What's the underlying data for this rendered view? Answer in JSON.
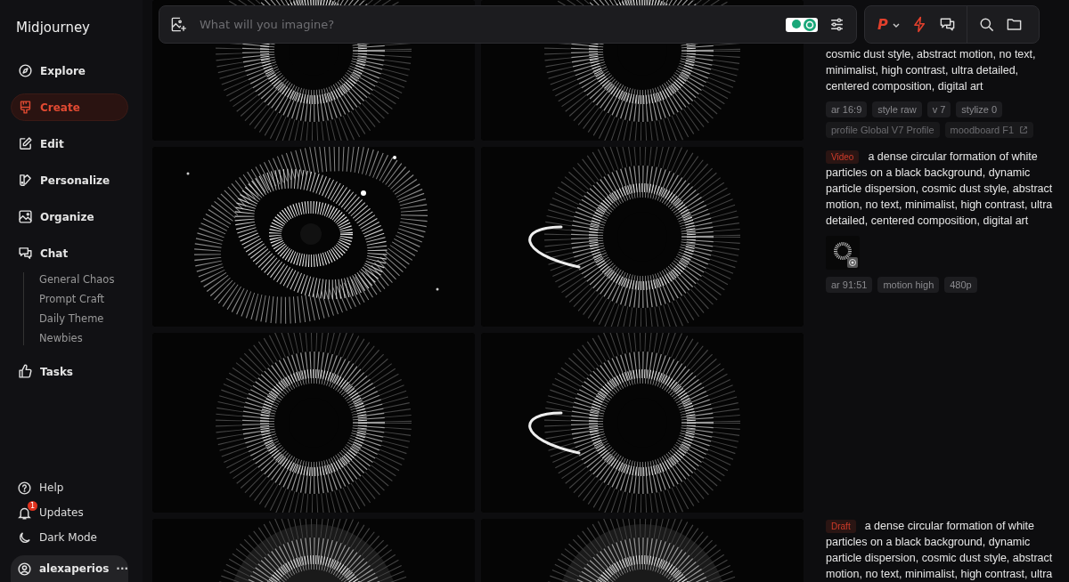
{
  "sidebar": {
    "logo": "Midjourney",
    "nav": [
      {
        "label": "Explore",
        "selected": false
      },
      {
        "label": "Create",
        "selected": true
      },
      {
        "label": "Edit",
        "selected": false
      },
      {
        "label": "Personalize",
        "selected": false
      },
      {
        "label": "Organize",
        "selected": false
      },
      {
        "label": "Chat",
        "selected": false,
        "children": [
          {
            "label": "General Chaos"
          },
          {
            "label": "Prompt Craft"
          },
          {
            "label": "Daily Theme"
          },
          {
            "label": "Newbies"
          }
        ]
      },
      {
        "label": "Tasks",
        "selected": false
      }
    ],
    "footer": [
      {
        "label": "Help"
      },
      {
        "label": "Updates",
        "badge": "1"
      },
      {
        "label": "Dark Mode"
      }
    ],
    "user": {
      "name": "alexaperios",
      "menu": "···"
    }
  },
  "prompt_bar": {
    "placeholder": "What will you imagine?"
  },
  "actions": {
    "profile_letter": "P"
  },
  "gallery": {
    "rows": [
      [
        {
          "kind": "picture"
        },
        {
          "kind": "picture"
        }
      ],
      [
        {
          "kind": "picture"
        },
        {
          "kind": "picture"
        }
      ],
      [
        {
          "kind": "picture"
        },
        {
          "kind": "picture"
        }
      ],
      [
        {
          "kind": "picture"
        },
        {
          "kind": "picture"
        }
      ]
    ]
  },
  "jobs": [
    {
      "prompt": "cosmic dust style, abstract motion, no text, minimalist, high contrast, ultra detailed, centered composition, digital art",
      "tags": [
        "ar 16:9",
        "style raw",
        "v 7",
        "stylize 0"
      ],
      "faded_tags": [
        "profile Global V7 Profile",
        "moodboard F1"
      ]
    },
    {
      "badge": "Video",
      "prompt": "a dense circular formation of white particles on a black background, dynamic particle dispersion, cosmic dust style, abstract motion, no text, minimalist, high contrast, ultra detailed, centered composition, digital art",
      "thumbnail": {
        "kind": "picture"
      },
      "tags": [
        "ar 91:51",
        "motion high",
        "480p"
      ]
    },
    {
      "badge": "Draft",
      "prompt": "a dense circular formation of white particles on a black background, dynamic particle dispersion, cosmic dust style, abstract motion, no text, minimalist, high contrast, ultra"
    }
  ]
}
